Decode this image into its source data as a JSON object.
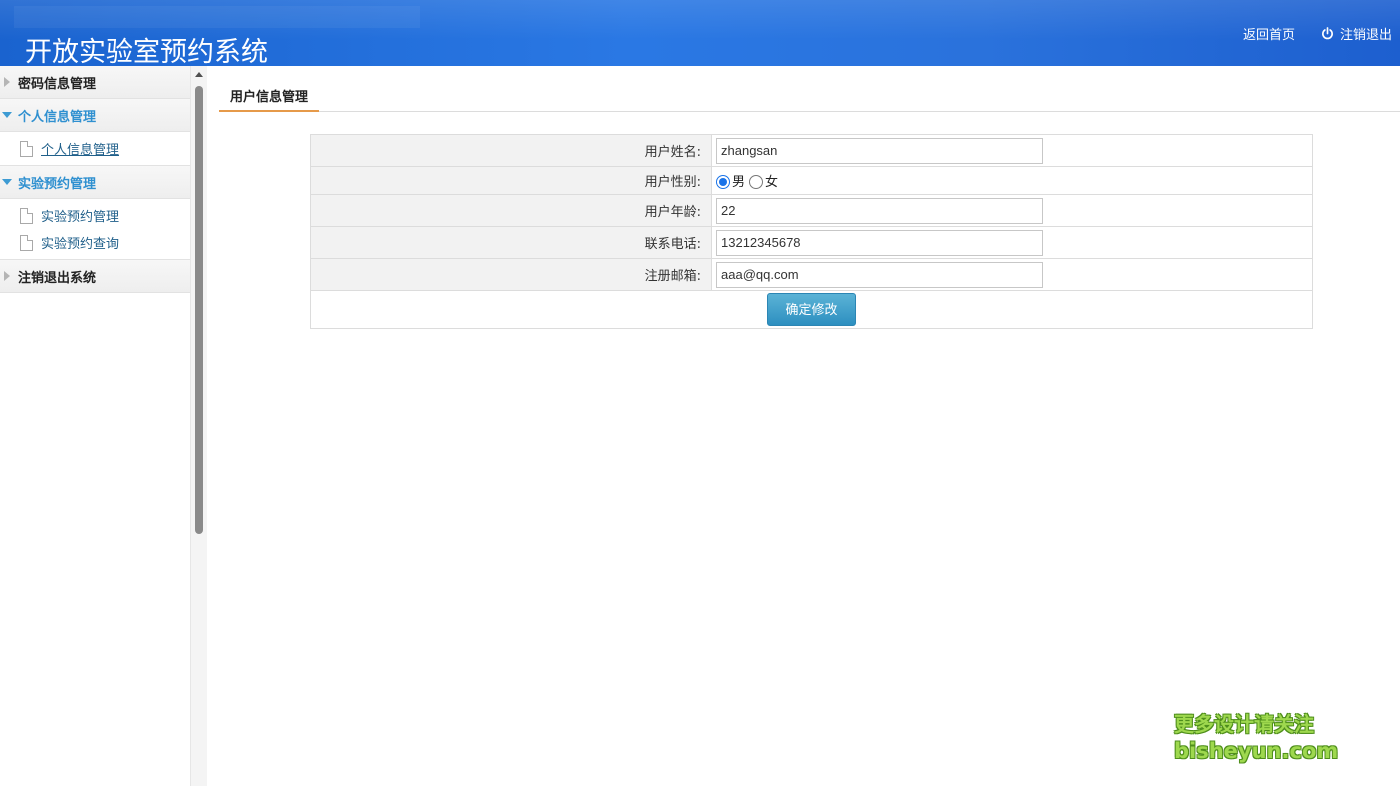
{
  "header": {
    "title": "开放实验室预约系统",
    "links": {
      "home": "返回首页",
      "logout": "注销退出"
    }
  },
  "sidebar": {
    "groups": [
      {
        "label": "密码信息管理",
        "expanded": false,
        "items": []
      },
      {
        "label": "个人信息管理",
        "expanded": true,
        "items": [
          {
            "label": "个人信息管理",
            "active": true
          }
        ]
      },
      {
        "label": "实验预约管理",
        "expanded": true,
        "items": [
          {
            "label": "实验预约管理"
          },
          {
            "label": "实验预约查询"
          }
        ]
      },
      {
        "label": "注销退出系统",
        "expanded": false,
        "items": []
      }
    ]
  },
  "main": {
    "tab_label": "用户信息管理",
    "form": {
      "name_label": "用户姓名:",
      "name_value": "zhangsan",
      "gender_label": "用户性别:",
      "gender_options": [
        "男",
        "女"
      ],
      "gender_selected": "男",
      "age_label": "用户年龄:",
      "age_value": "22",
      "phone_label": "联系电话:",
      "phone_value": "13212345678",
      "email_label": "注册邮箱:",
      "email_value": "aaa@qq.com",
      "submit_label": "确定修改"
    }
  },
  "watermark": {
    "line1": "更多设计请关注",
    "line2": "bisheyun.com"
  },
  "colors": {
    "header_bg": "#2a78e4",
    "accent_blue": "#2f90d0",
    "tab_underline": "#e69a4a",
    "button_bg": "#2d8fc0",
    "watermark_green": "#9ed84e"
  }
}
